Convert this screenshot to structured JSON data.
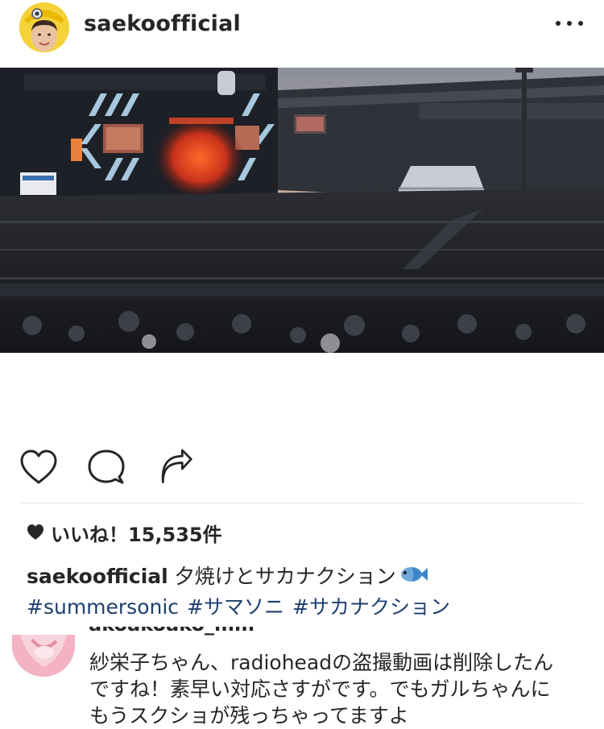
{
  "post": {
    "username": "saekoofficial",
    "more_icon": "more-horizontal-icon",
    "photo_alt": "",
    "likes_text": "いいね！15,535件",
    "caption_user": "saekoofficial",
    "caption_text": "夕焼けとサカナクション",
    "caption_emoji": "fish-emoji",
    "hashtags": [
      "#summersonic",
      "#サマソニ",
      "#サカナクション"
    ]
  },
  "actions": {
    "like_icon": "heart-outline-icon",
    "comment_icon": "comment-bubble-icon",
    "share_icon": "share-arrow-icon"
  },
  "comment": {
    "username_partial": "akoakoako_mm",
    "lines": [
      "紗栄子ちゃん、radioheadの盗撮動画は削除したん",
      "ですね！素早い対応さすがです。でもガルちゃんに",
      "もうスクショが残っちゃってますよ"
    ]
  },
  "colors": {
    "text": "#262626",
    "hashtag": "#1f3f6e",
    "divider": "#e6e6e6"
  }
}
